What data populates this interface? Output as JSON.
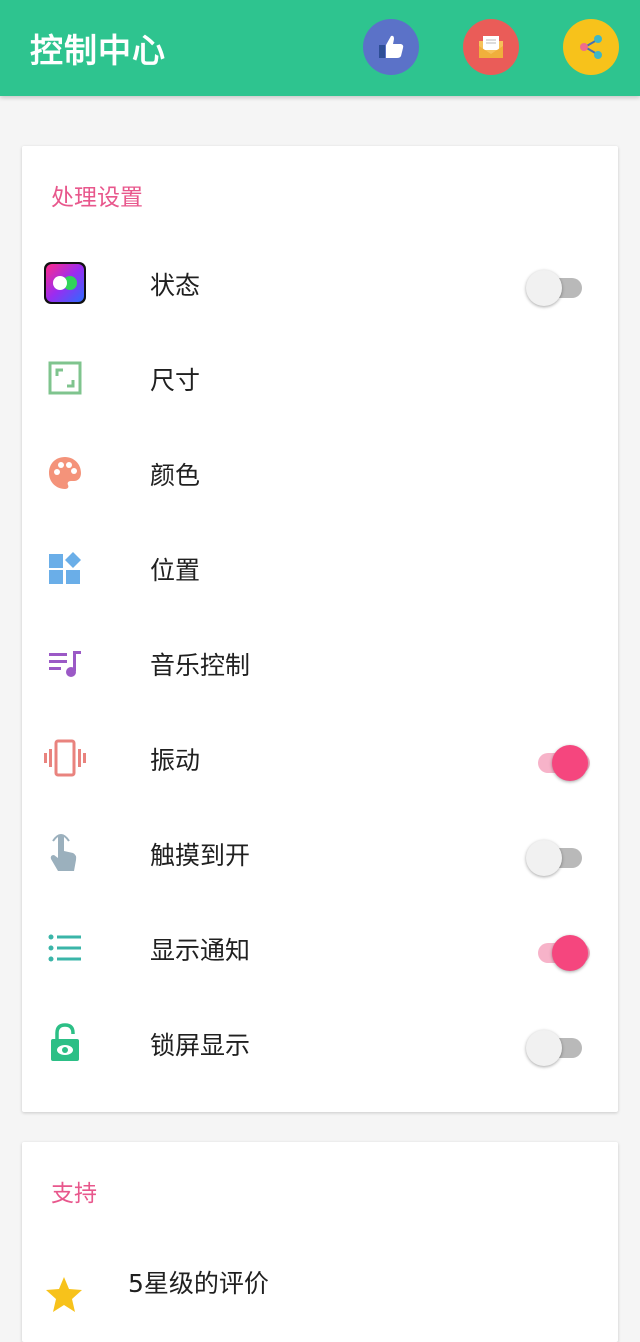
{
  "appbar": {
    "title": "控制中心",
    "buttons": [
      {
        "icon": "thumbs-up-icon",
        "color": "#5b72c8"
      },
      {
        "icon": "mail-icon",
        "color": "#ea5c58"
      },
      {
        "icon": "share-icon",
        "color": "#f7c21b"
      }
    ]
  },
  "settings": {
    "title": "处理设置",
    "items": [
      {
        "label": "状态",
        "icon": "status-icon",
        "toggle": false
      },
      {
        "label": "尺寸",
        "icon": "size-icon"
      },
      {
        "label": "颜色",
        "icon": "palette-icon"
      },
      {
        "label": "位置",
        "icon": "position-icon"
      },
      {
        "label": "音乐控制",
        "icon": "music-icon"
      },
      {
        "label": "振动",
        "icon": "vibration-icon",
        "toggle": true
      },
      {
        "label": "触摸到开",
        "icon": "touch-icon",
        "toggle": false
      },
      {
        "label": "显示通知",
        "icon": "list-icon",
        "toggle": true
      },
      {
        "label": "锁屏显示",
        "icon": "lock-icon",
        "toggle": false
      }
    ]
  },
  "support": {
    "title": "支持",
    "rating_label": "5星级的评价"
  },
  "colors": {
    "primary": "#2ec48f",
    "accent": "#f5467e",
    "section_title": "#e8578c"
  }
}
